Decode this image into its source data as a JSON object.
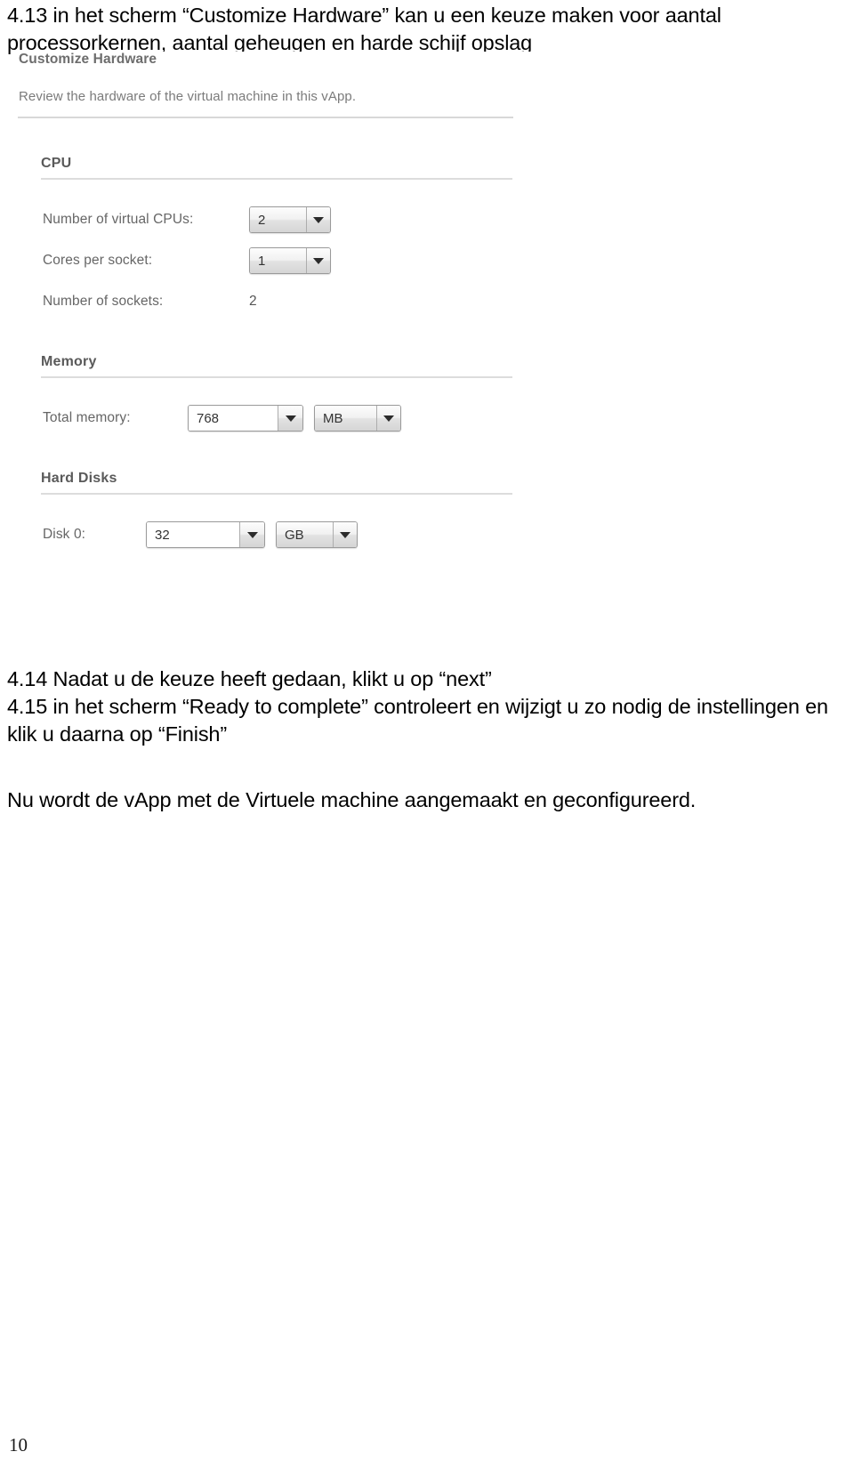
{
  "document": {
    "page_number": "10",
    "intro_paragraph": "4.13 in het scherm “Customize Hardware” kan u een keuze maken voor aantal processorkernen, aantal geheugen en harde schijf opslag",
    "steps_paragraph": "4.14 Nadat u de keuze heeft gedaan, klikt u op “next”\n4.15 in het scherm “Ready to complete” controleert en wijzigt u zo nodig de instellingen en klik u daarna op “Finish”",
    "closing_paragraph": "Nu wordt de vApp met de Virtuele machine aangemaakt en geconfigureerd."
  },
  "screenshot": {
    "title": "Customize Hardware",
    "subtitle": "Review the hardware of the virtual machine in this vApp.",
    "sections": [
      {
        "heading": "CPU",
        "rows": [
          {
            "label": "Number of virtual CPUs:",
            "value": "2",
            "control": "dropdown"
          },
          {
            "label": "Cores per socket:",
            "value": "1",
            "control": "dropdown"
          },
          {
            "label": "Number of sockets:",
            "value": "2",
            "control": "static"
          }
        ]
      },
      {
        "heading": "Memory",
        "rows": [
          {
            "label": "Total memory:",
            "value": "768",
            "unit": "MB",
            "control": "combo-with-unit"
          }
        ]
      },
      {
        "heading": "Hard Disks",
        "rows": [
          {
            "label": "Disk 0:",
            "value": "32",
            "unit": "GB",
            "control": "combo-with-unit"
          }
        ]
      }
    ],
    "colors": {
      "heading_text": "#5a5a5a",
      "label_text": "#666666",
      "rule": "#d8d8d8",
      "control_border": "#9a9a9a"
    }
  }
}
